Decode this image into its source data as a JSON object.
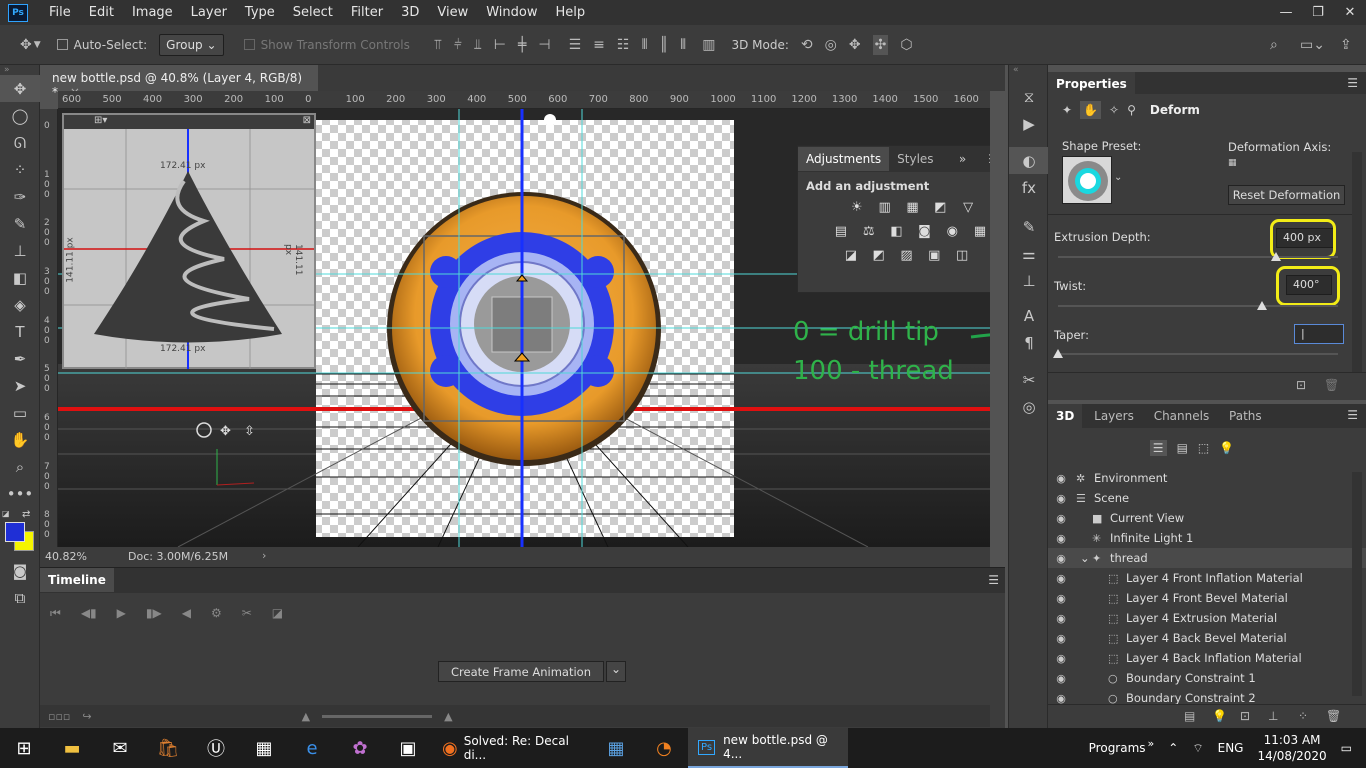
{
  "menubar": {
    "logo": "Ps",
    "items": [
      "File",
      "Edit",
      "Image",
      "Layer",
      "Type",
      "Select",
      "Filter",
      "3D",
      "View",
      "Window",
      "Help"
    ],
    "window_controls": [
      "—",
      "❐",
      "✕"
    ]
  },
  "options": {
    "auto_select_label": "Auto-Select:",
    "group_value": "Group",
    "show_transform": "Show Transform Controls",
    "mode_label": "3D Mode:"
  },
  "document": {
    "tab_title": "new bottle.psd @ 40.8% (Layer 4, RGB/8) *",
    "close": "×",
    "zoom": "40.82%",
    "doc_size": "Doc: 3.00M/6.25M"
  },
  "ruler": {
    "h_ticks": [
      "600",
      "500",
      "400",
      "300",
      "200",
      "100",
      "0",
      "100",
      "200",
      "300",
      "400",
      "500",
      "600",
      "700",
      "800",
      "900",
      "1000",
      "1100",
      "1200",
      "1300",
      "1400",
      "1500",
      "1600"
    ],
    "v_ticks": [
      "0",
      "1 0 0",
      "2 0 0",
      "3 0 0",
      "4 0 0",
      "5 0 0",
      "6 0 0",
      "7 0 0",
      "8 0 0"
    ]
  },
  "preview": {
    "top_label": "172.41 px",
    "bottom_label": "172.41 px",
    "left_label": "141.11 px",
    "right_label": "141.11 px"
  },
  "annotations": {
    "line1": "0 = drill tip",
    "line2": "100 - thread"
  },
  "adjustments": {
    "tabs": [
      "Adjustments",
      "Styles"
    ],
    "heading": "Add an adjustment",
    "row1": [
      "☀",
      "▥",
      "▦",
      "◩",
      "▽"
    ],
    "row2": [
      "▤",
      "⚖",
      "◧",
      "◙",
      "◉",
      "▦"
    ],
    "row3": [
      "◪",
      "◩",
      "▨",
      "▣",
      "◫"
    ]
  },
  "timeline": {
    "title": "Timeline",
    "create_button": "Create Frame Animation"
  },
  "properties": {
    "title": "Properties",
    "section": "Deform",
    "shape_preset_label": "Shape Preset:",
    "deformation_axis_label": "Deformation Axis:",
    "reset_button": "Reset Deformation",
    "extrusion_label": "Extrusion Depth:",
    "extrusion_value": "400 px",
    "twist_label": "Twist:",
    "twist_value": "400°",
    "taper_label": "Taper:",
    "taper_value": "|",
    "extrusion_slider": 0.78,
    "twist_slider": 0.73,
    "taper_slider": 0.0
  },
  "panel3d": {
    "tabs": [
      "3D",
      "Layers",
      "Channels",
      "Paths"
    ],
    "items": [
      {
        "name": "Environment",
        "indent": 0,
        "icon": "✲"
      },
      {
        "name": "Scene",
        "indent": 0,
        "icon": "☰"
      },
      {
        "name": "Current View",
        "indent": 1,
        "icon": "■"
      },
      {
        "name": "Infinite Light 1",
        "indent": 1,
        "icon": "✳"
      },
      {
        "name": "thread",
        "indent": 1,
        "icon": "✦"
      },
      {
        "name": "Layer 4 Front Inflation Material",
        "indent": 2,
        "icon": "⬚"
      },
      {
        "name": "Layer 4 Front Bevel Material",
        "indent": 2,
        "icon": "⬚"
      },
      {
        "name": "Layer 4 Extrusion Material",
        "indent": 2,
        "icon": "⬚"
      },
      {
        "name": "Layer 4 Back Bevel Material",
        "indent": 2,
        "icon": "⬚"
      },
      {
        "name": "Layer 4 Back Inflation Material",
        "indent": 2,
        "icon": "⬚"
      },
      {
        "name": "Boundary Constraint 1",
        "indent": 2,
        "icon": "○"
      },
      {
        "name": "Boundary Constraint 2",
        "indent": 2,
        "icon": "○"
      }
    ]
  },
  "taskbar": {
    "firefox_title": "Solved: Re: Decal di...",
    "ps_title": "new bottle.psd @ 4...",
    "programs": "Programs",
    "chevron": "»",
    "lang": "ENG",
    "time": "11:03 AM",
    "date": "14/08/2020"
  },
  "colors": {
    "highlight": "#f2ec17",
    "annotation": "#2fb34a",
    "foreground": "#1f2fd6",
    "background": "#f5f500"
  }
}
